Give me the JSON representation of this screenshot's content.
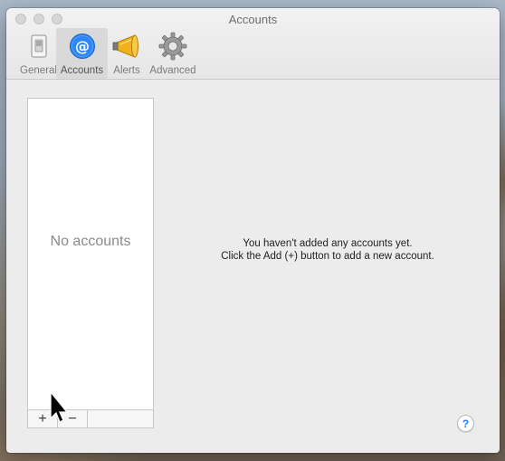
{
  "window": {
    "title": "Accounts"
  },
  "toolbar": {
    "items": [
      {
        "label": "General",
        "icon": "switch-icon",
        "selected": false
      },
      {
        "label": "Accounts",
        "icon": "at-sign-icon",
        "selected": true
      },
      {
        "label": "Alerts",
        "icon": "megaphone-icon",
        "selected": false
      },
      {
        "label": "Advanced",
        "icon": "gear-icon",
        "selected": false
      }
    ]
  },
  "accounts_list": {
    "empty_text": "No accounts",
    "add_label": "+",
    "remove_label": "−"
  },
  "main": {
    "message_line1": "You haven't added any accounts yet.",
    "message_line2": "Click the Add (+) button to add a new account."
  },
  "help": {
    "label": "?"
  },
  "colors": {
    "accent": "#2f7cf6",
    "window_bg": "#ececec"
  }
}
